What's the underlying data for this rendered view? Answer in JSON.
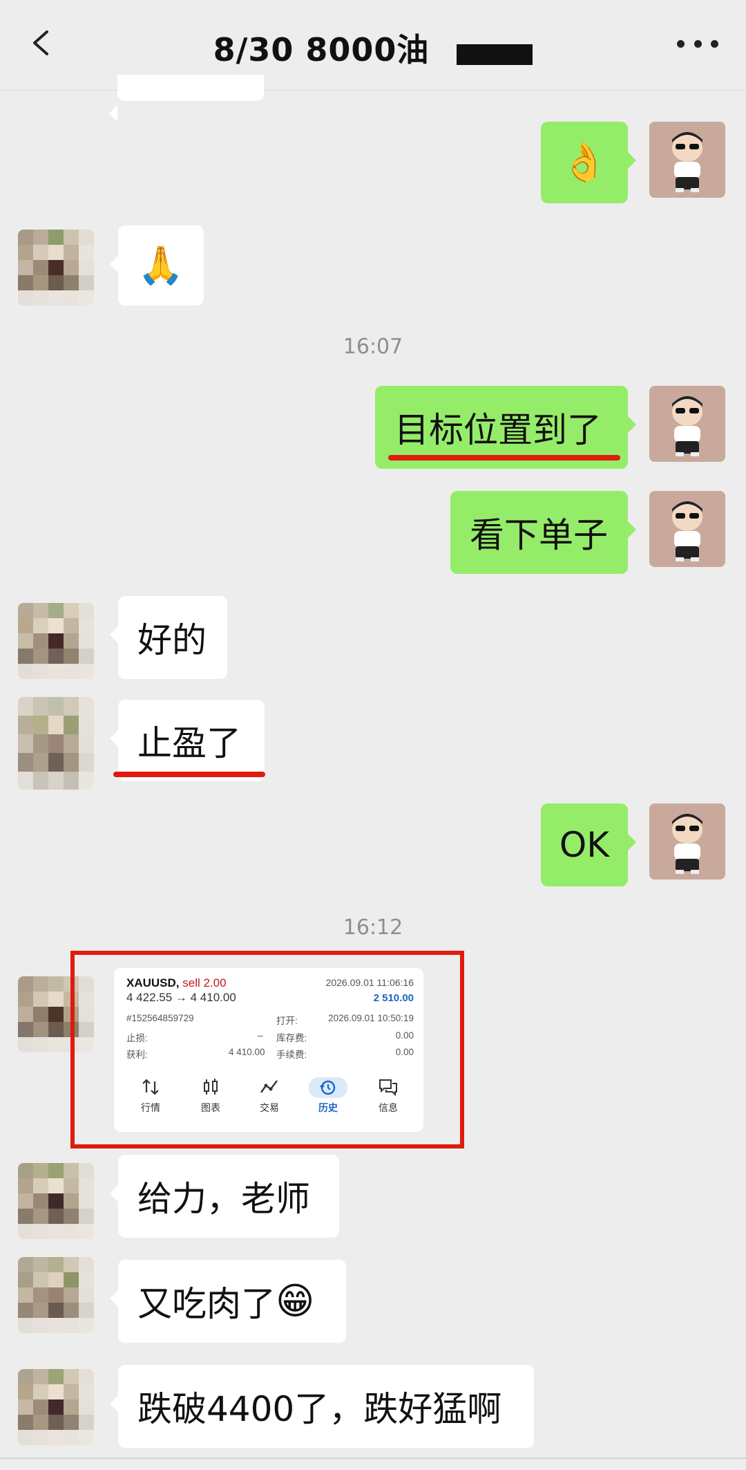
{
  "header": {
    "title": "8/30  8000油",
    "back_icon": "chevron-left-icon",
    "more_icon": "more-dots-icon"
  },
  "messages": {
    "m1_emoji": "👌",
    "m2_emoji": "🙏",
    "time1": "16:07",
    "m3": "目标位置到了",
    "m4": "看下单子",
    "m5": "好的",
    "m6": "止盈了",
    "m7": "OK",
    "time2": "16:12",
    "m9": "给力，老师",
    "m10_text": "又吃肉了",
    "m10_emoji": "😁",
    "m11": "跌破4400了，跌好猛啊"
  },
  "trade_card": {
    "symbol": "XAUUSD,",
    "side": "sell 2.00",
    "close_time": "2026.09.01 11:06:16",
    "price_move": "4 422.55 → 4 410.00",
    "profit": "2 510.00",
    "order_id": "#152564859729",
    "open_label": "打开:",
    "open_time": "2026.09.01 10:50:19",
    "sl_label": "止损:",
    "sl_value": "–",
    "swap_label": "库存费:",
    "swap_value": "0.00",
    "tp_label": "获利:",
    "tp_value": "4 410.00",
    "commission_label": "手续费:",
    "commission_value": "0.00",
    "nav": [
      {
        "label": "行情",
        "icon": "quotes-icon"
      },
      {
        "label": "图表",
        "icon": "chart-icon"
      },
      {
        "label": "交易",
        "icon": "trade-icon"
      },
      {
        "label": "历史",
        "icon": "history-icon"
      },
      {
        "label": "信息",
        "icon": "messages-icon"
      }
    ]
  },
  "colors": {
    "outgoing_bubble": "#95ec69",
    "incoming_bubble": "#ffffff",
    "highlight_red": "#e01b0e",
    "active_tab": "#1a66c7"
  }
}
